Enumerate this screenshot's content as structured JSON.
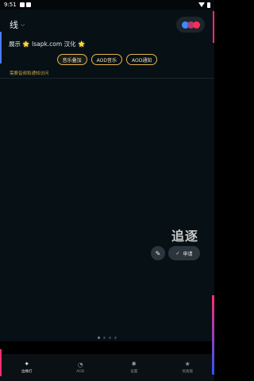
{
  "status_bar": {
    "time": "9:51"
  },
  "header": {
    "title": "线",
    "chevron_icon": "chevron-down-icon"
  },
  "promo": {
    "text": "展示 🌟 lsapk.com 汉化 🌟"
  },
  "modes": [
    {
      "label": "音乐叠加",
      "active": true
    },
    {
      "label": "AOD音乐",
      "active": false
    },
    {
      "label": "AOD通知",
      "active": false
    }
  ],
  "warning": {
    "text": "需要音频和通知访问"
  },
  "effect": {
    "name": "追逐",
    "edit_icon": "pencil-icon",
    "apply_label": "申请",
    "apply_icon": "check-icon"
  },
  "pager": {
    "total": 4,
    "current": 1
  },
  "nav": [
    {
      "label": "边缘灯",
      "icon": "edge-light-icon",
      "active": true
    },
    {
      "label": "AOD",
      "icon": "aod-icon",
      "active": false
    },
    {
      "label": "设置",
      "icon": "settings-icon",
      "active": false
    },
    {
      "label": "优质版",
      "icon": "star-icon",
      "active": false
    }
  ],
  "colors": {
    "accent": "#e6b24a",
    "edge_pink": "#ff2d6f",
    "edge_blue": "#4a7cff",
    "background": "#061015"
  }
}
